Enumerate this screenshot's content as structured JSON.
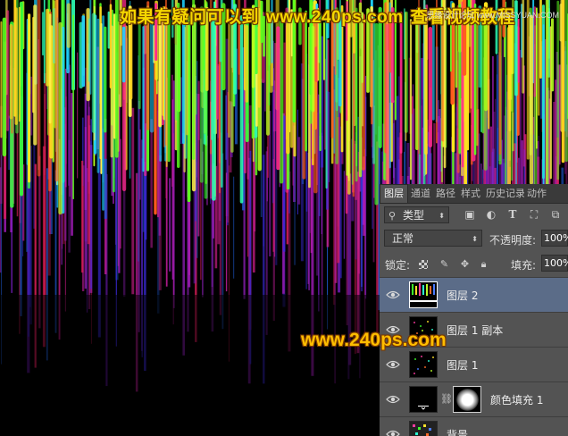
{
  "canvas": {
    "title_cn_1": "如果有疑问可以到",
    "title_url": "www.240ps.com",
    "title_cn_2": "查看视频教程",
    "corner_watermark": "思缘设计论坛 www.MISSYUAN.COM",
    "mid_watermark": "www.240ps.com"
  },
  "panel": {
    "tabs": [
      {
        "label": "图层",
        "active": true
      },
      {
        "label": "通道",
        "active": false
      },
      {
        "label": "路径",
        "active": false
      },
      {
        "label": "样式",
        "active": false
      },
      {
        "label": "历史记录",
        "active": false
      },
      {
        "label": "动作",
        "active": false
      }
    ],
    "filter": {
      "kind_label": "类型"
    },
    "filter_icons": [
      "image-filter-icon",
      "adjustment-filter-icon",
      "type-filter-icon",
      "shape-filter-icon",
      "smart-object-filter-icon"
    ],
    "blend_mode": "正常",
    "opacity_label": "不透明度:",
    "opacity_value": "100%",
    "lock_label": "锁定:",
    "lock_icons": [
      "lock-transparent-icon",
      "lock-image-icon",
      "lock-position-icon",
      "lock-all-icon"
    ],
    "fill_label": "填充:",
    "fill_value": "100%",
    "layers": [
      {
        "name": "图层 2",
        "selected": true
      },
      {
        "name": "图层 1 副本",
        "selected": false
      },
      {
        "name": "图层 1",
        "selected": false
      },
      {
        "name": "颜色填充 1",
        "selected": false
      },
      {
        "name": "背景",
        "selected": false
      }
    ]
  },
  "colors": {
    "panel_bg": "#535353",
    "tab_bar_bg": "#3a3a3a",
    "selected_layer": "#5b6c88",
    "watermark_yellow": "#f5d800",
    "watermark_orange": "#ffbe00"
  }
}
